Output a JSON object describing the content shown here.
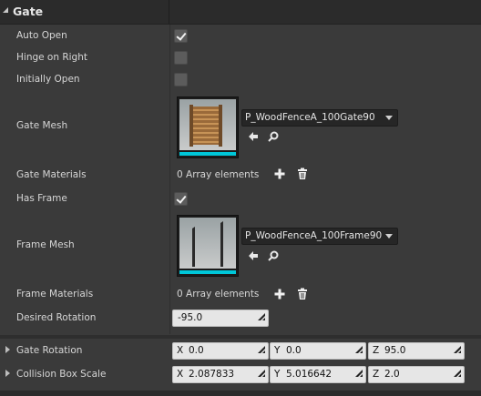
{
  "section": {
    "title": "Gate"
  },
  "rows": {
    "auto_open": {
      "label": "Auto Open",
      "checked": true
    },
    "hinge_on_right": {
      "label": "Hinge on Right",
      "checked": false
    },
    "initially_open": {
      "label": "Initially Open",
      "checked": false
    },
    "gate_mesh": {
      "label": "Gate Mesh",
      "asset": "P_WoodFenceA_100Gate90"
    },
    "gate_materials": {
      "label": "Gate Materials",
      "value": "0 Array elements"
    },
    "has_frame": {
      "label": "Has Frame",
      "checked": true
    },
    "frame_mesh": {
      "label": "Frame Mesh",
      "asset": "P_WoodFenceA_100Frame90"
    },
    "frame_materials": {
      "label": "Frame Materials",
      "value": "0 Array elements"
    },
    "desired_rotation": {
      "label": "Desired Rotation",
      "value": "-95.0"
    },
    "gate_rotation": {
      "label": "Gate Rotation",
      "x_label": "X",
      "x": "0.0",
      "y_label": "Y",
      "y": "0.0",
      "z_label": "Z",
      "z": "95.0"
    },
    "collision_box_scale": {
      "label": "Collision Box Scale",
      "x_label": "X",
      "x": "2.087833",
      "y_label": "Y",
      "y": "5.016642",
      "z_label": "Z",
      "z": "2.0"
    }
  },
  "icons": {
    "use_selected": "left-arrow-icon",
    "browse": "search-icon",
    "add": "plus-icon",
    "delete": "trash-icon",
    "grip": "resize-grip-icon",
    "expand": "expand-arrow-icon",
    "collapse": "collapse-arrow-icon"
  },
  "colors": {
    "accent_cyan": "#00c7d9",
    "panel_bg": "#3a3a3a",
    "header_bg": "#2b2b2b"
  }
}
